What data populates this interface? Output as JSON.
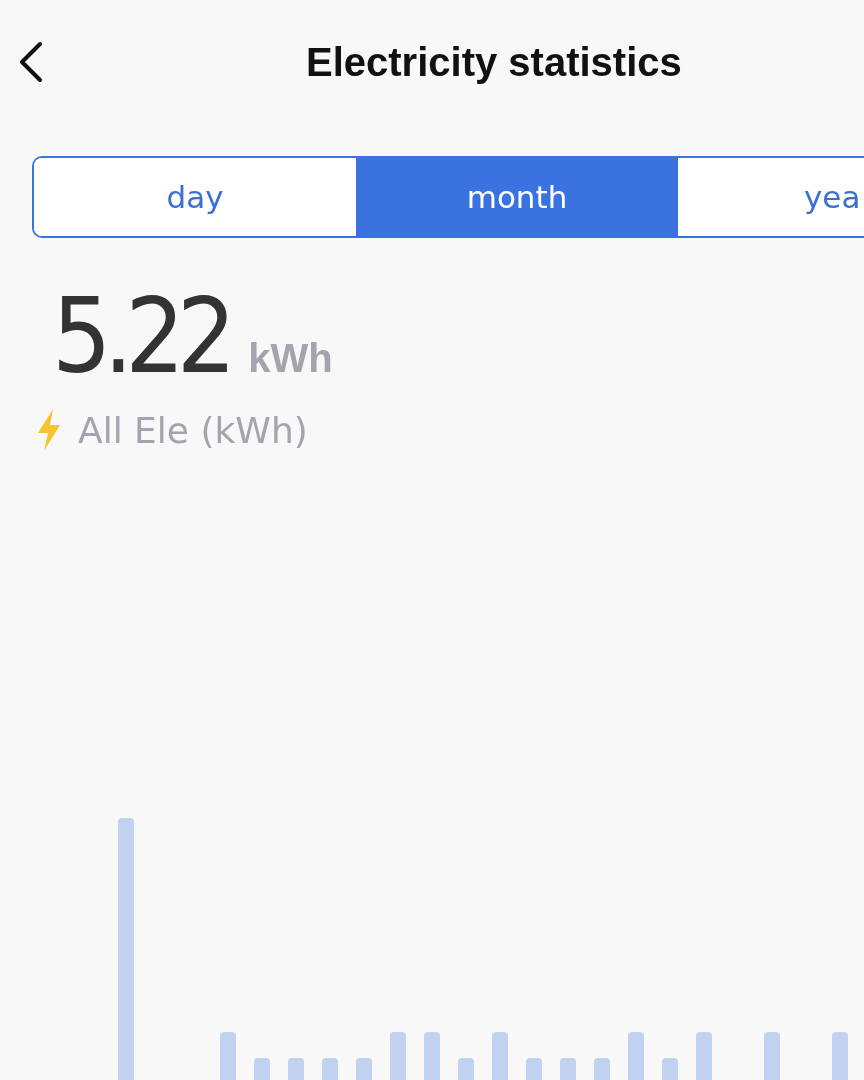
{
  "header": {
    "title": "Electricity statistics"
  },
  "tabs": [
    {
      "label": "day",
      "selected": false
    },
    {
      "label": "month",
      "selected": true
    },
    {
      "label": "yea",
      "selected": false
    }
  ],
  "total": {
    "value": "5.22",
    "unit": "kWh"
  },
  "legend": {
    "label": "All Ele (kWh)"
  }
}
